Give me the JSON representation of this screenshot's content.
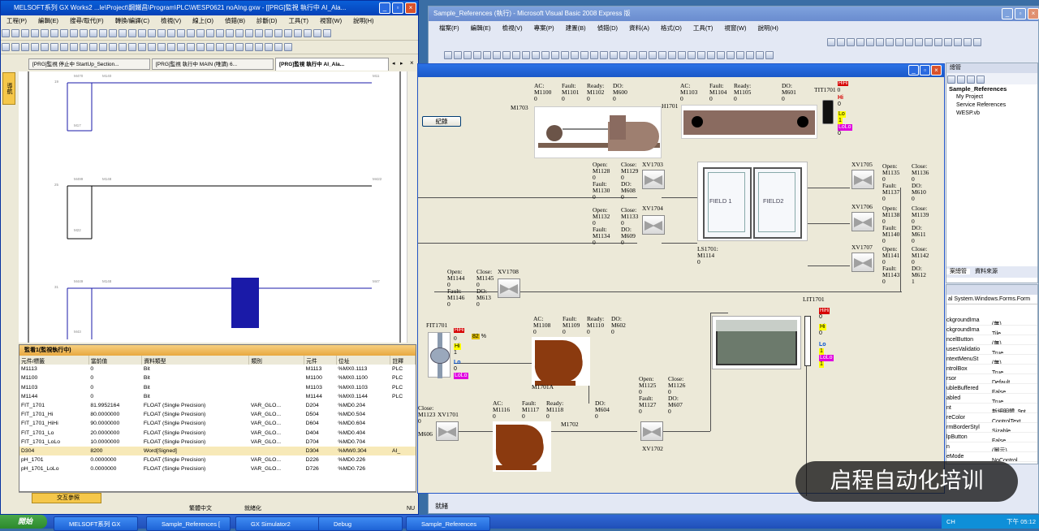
{
  "gx": {
    "title": "MELSOFT系列 GX Works2 ...le\\Project\\鋼鐵昌\\Program\\PLC\\WESP0621 noAIng.gxw - [[PRG]監視 執行中 AI_Ala...",
    "menu": [
      "工程(P)",
      "編輯(E)",
      "搜尋/取代(F)",
      "轉換/編譯(C)",
      "檢視(V)",
      "線上(O)",
      "偵錯(B)",
      "診斷(D)",
      "工具(T)",
      "視窗(W)",
      "說明(H)"
    ],
    "tabs": [
      "[PRG]監視 停止中 StartUp_Section...",
      "[PRG]監視 執行中 MAIN (唯讀) 6...",
      "[PRG]監視 執行中 AI_Ala..."
    ],
    "side_tab": "導航",
    "ladder": {
      "rows": [
        "19",
        "25",
        "31"
      ],
      "contacts_r1": [
        "M470",
        "M140",
        "M11",
        "M17"
      ],
      "contacts_r2": [
        "M499",
        "M148",
        "M22",
        "M422"
      ],
      "contacts_r3": [
        "M449",
        "M148",
        "M47",
        "M43"
      ]
    },
    "watch": {
      "title": "監看1(監視執行中)",
      "columns": [
        "元件/標籤",
        "當前值",
        "資料類型",
        "類別",
        "元件",
        "位址",
        "註釋"
      ],
      "rows": [
        [
          "M1113",
          "0",
          "Bit",
          "",
          "M1113",
          "%MX0.1113",
          "PLC"
        ],
        [
          "M1100",
          "0",
          "Bit",
          "",
          "M1100",
          "%MX0.1100",
          "PLC"
        ],
        [
          "M1103",
          "0",
          "Bit",
          "",
          "M1103",
          "%MX0.1103",
          "PLC"
        ],
        [
          "M1144",
          "0",
          "Bit",
          "",
          "M1144",
          "%MX0.1144",
          "PLC"
        ],
        [
          "FIT_1701",
          "81.9952164",
          "FLOAT (Single Precision)",
          "VAR_GLO...",
          "D204",
          "%MD0.204",
          ""
        ],
        [
          "FIT_1701_Hi",
          "80.0000000",
          "FLOAT (Single Precision)",
          "VAR_GLO...",
          "D504",
          "%MD0.504",
          ""
        ],
        [
          "FIT_1701_HiHi",
          "90.0000000",
          "FLOAT (Single Precision)",
          "VAR_GLO...",
          "D604",
          "%MD0.604",
          ""
        ],
        [
          "FIT_1701_Lo",
          "20.0000000",
          "FLOAT (Single Precision)",
          "VAR_GLO...",
          "D404",
          "%MD0.404",
          ""
        ],
        [
          "FIT_1701_LoLo",
          "10.0000000",
          "FLOAT (Single Precision)",
          "VAR_GLO...",
          "D704",
          "%MD0.704",
          ""
        ],
        [
          "D304",
          "8200",
          "Word[Signed]",
          "",
          "D304",
          "%MW0.304",
          "AI_"
        ],
        [
          "pH_1701",
          "0.0000000",
          "FLOAT (Single Precision)",
          "VAR_GLO...",
          "D226",
          "%MD0.226",
          ""
        ],
        [
          "pH_1701_LoLo",
          "0.0000000",
          "FLOAT (Single Precision)",
          "VAR_GLO...",
          "D726",
          "%MD0.726",
          ""
        ]
      ],
      "bottom_tab": "交互參照"
    },
    "status": [
      "繁體中文",
      "就緒化",
      "NU"
    ]
  },
  "vb": {
    "title": "Sample_References (執行) - Microsoft Visual Basic 2008 Express 版",
    "menu": [
      "檔案(F)",
      "編輯(E)",
      "檢視(V)",
      "專案(P)",
      "建置(B)",
      "偵錯(D)",
      "資料(A)",
      "格式(O)",
      "工具(T)",
      "視窗(W)",
      "說明(H)"
    ],
    "status": "就緒",
    "solution": {
      "title": "總管",
      "root": "Sample_References",
      "items": [
        "My Project",
        "Service References",
        "WESP.vb"
      ],
      "tabs": [
        "案總管",
        "資料來源"
      ]
    },
    "props": {
      "object": "al System.Windows.Forms.Form",
      "rows": [
        [
          "ckgroundIma",
          "(無)"
        ],
        [
          "ckgroundIma",
          "Tile"
        ],
        [
          "ncelButton",
          "(無)"
        ],
        [
          "usesValidatio",
          "True"
        ],
        [
          "ntextMenuSt",
          "(無)"
        ],
        [
          "ntrolBox",
          "True"
        ],
        [
          "rsor",
          "Default"
        ],
        [
          "ubleBuffered",
          "False"
        ],
        [
          "abled",
          "True"
        ],
        [
          "nt",
          "新細明體, 9pt"
        ],
        [
          "reColor",
          "ControlText"
        ],
        [
          "rmBorderStyl",
          "Sizable"
        ],
        [
          "lpButton",
          "False"
        ],
        [
          "n",
          "(圖示)"
        ],
        [
          "eMode",
          "NoControl"
        ]
      ]
    }
  },
  "hmi": {
    "record_button": "紀錄",
    "m1703": {
      "label": "M1703",
      "ac": "AC:\nM1100\n0",
      "fault": "Fault:\nM1101\n0",
      "ready": "Ready:\nM1102\n0",
      "do": "DO:\nM600\n0"
    },
    "h1701": {
      "label": "H1701",
      "ac": "AC:\nM1103\n0",
      "fault": "Fault:\nM1104\n0",
      "ready": "Ready:\nM1105\n0",
      "do": "DO:\nM601\n0"
    },
    "tit1701": {
      "label": "TIT1701",
      "value": "0",
      "hihi": "HiHi",
      "hi": "Hi",
      "hi_v": "0",
      "lo": "Lo",
      "lo_v": "1",
      "lolo": "LoLo",
      "lolo_v": "0"
    },
    "xv1703": {
      "label": "XV1703",
      "open": "Open:\nM1128\n0",
      "close": "Close:\nM1129\n0",
      "fault": "Fault:\nM1130\n0",
      "do": "DO:\nM608\n0"
    },
    "xv1704": {
      "label": "XV1704",
      "open": "Open:\nM1132\n0",
      "close": "Close:\nM1133\n0",
      "fault": "Fault:\nM1134\n0",
      "do": "DO:\nM609\n0"
    },
    "field": {
      "f1": "FIELD 1",
      "f2": "FIELD2",
      "ls": "LS1701:\nM1114\n0"
    },
    "xv1705": {
      "label": "XV1705",
      "open": "Open:\nM1135\n0",
      "close": "Close:\nM1136\n0",
      "fault": "Fault:\nM1137\n0",
      "do": "DO:\nM610\n0"
    },
    "xv1706": {
      "label": "XV1706",
      "open": "Open:\nM1138\n0",
      "close": "Close:\nM1139\n0",
      "fault": "Fault:\nM1140\n0",
      "do": "DO:\nM611\n0"
    },
    "xv1707": {
      "label": "XV1707",
      "open": "Open:\nM1141\n0",
      "close": "Close:\nM1142\n0",
      "fault": "Fault:\nM1143\n0",
      "do": "DO:\nM612\n1"
    },
    "xv1708": {
      "label": "XV1708",
      "open": "Open:\nM1144\n0",
      "close": "Close:\nM1145\n0",
      "fault": "Fault:\nM1146\n0",
      "do": "DO:\nM613\n0"
    },
    "fit1701": {
      "label": "FIT1701",
      "value": "82",
      "unit": "%",
      "hihi": "HiHi",
      "hihi_v": "0",
      "hi": "Hi",
      "hi_v": "1",
      "lo": "Lo",
      "lo_v": "0",
      "lolo": "LoLo"
    },
    "m1701a": {
      "label": "M1701A",
      "ac": "AC:\nM1108\n0",
      "fault": "Fault:\nM1109\n0",
      "ready": "Ready:\nM1110\n0",
      "do": "DO:\nM602\n0"
    },
    "lit1701": {
      "label": "LIT1701",
      "hihi": "HiHi",
      "hihi_v": "0",
      "hi": "Hi",
      "hi_v": "0",
      "lo": "Lo",
      "lo_v": "1",
      "lolo": "LoLo",
      "lolo_v": "1"
    },
    "xv1702": {
      "label": "XV1702",
      "open": "Open:\nM1125\n0",
      "close": "Close:\nM1126\n0",
      "fault": "Fault:\nM1127\n0",
      "do": "DO:\nM607\n0"
    },
    "m1702": {
      "label": "M1702",
      "ac": "AC:\nM1116\n0",
      "fault": "Fault:\nM1117\n0",
      "ready": "Ready:\nM1118\n0",
      "do": "DO:\nM604\n0"
    },
    "xv1701": {
      "label": "XV1701",
      "close": "Close:\nM1123\n0",
      "do": "M606"
    }
  },
  "watermark": "启程自动化培训",
  "taskbar": {
    "start": "開始",
    "buttons": [
      "MELSOFT系列 GX",
      "Sample_References [",
      "GX Simulator2",
      "Debug",
      "Sample_References"
    ],
    "tray_lang": "CH",
    "clock": "下午 05:12"
  },
  "colors": {
    "titlebar": "#0a5fd8",
    "motor": "#8b3a0f",
    "alarm": "#d60000",
    "ok": "#ffff00",
    "lolo": "#e000e0",
    "cursor_block": "#1a1aa8"
  }
}
